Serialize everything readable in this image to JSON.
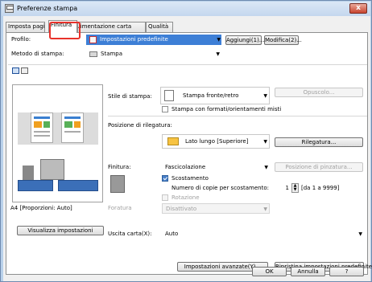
{
  "window": {
    "title": "Preferenze stampa",
    "close_label": "x"
  },
  "tabs": [
    {
      "label": "Imposta pagina"
    },
    {
      "label": "Finitura"
    },
    {
      "label": "Alimentazione carta"
    },
    {
      "label": "Qualità"
    }
  ],
  "profilo": {
    "label": "Profilo:",
    "value": "Impostazioni predefinite",
    "add_button": "Aggiungi(1)...",
    "edit_button": "Modifica(2)..."
  },
  "metodo": {
    "label": "Metodo di stampa:",
    "value": "Stampa"
  },
  "stile": {
    "label": "Stile di stampa:",
    "value": "Stampa fronte/retro",
    "opuscolo_button": "Opuscolo...",
    "mixed_label": "Stampa con formati/orientamenti misti"
  },
  "rilegatura": {
    "label": "Posizione di rilegatura:",
    "value": "Lato lungo [Superiore]",
    "button": "Rilegatura..."
  },
  "finitura": {
    "label": "Finitura:",
    "value": "Fascicolazione",
    "pinzatura_button": "Posizione di pinzatura...",
    "scostamento_label": "Scostamento",
    "copie_label": "Numero di copie per scostamento:",
    "copie_value": "1",
    "copie_range": "[da 1 a 9999]",
    "rotazione_label": "Rotazione",
    "foratura_label": "Foratura",
    "foratura_value": "Disattivato"
  },
  "preview": {
    "caption": "A4 [Proporzioni: Auto]",
    "show_settings_button": "Visualizza impostazioni"
  },
  "uscita": {
    "label": "Uscita carta(X):",
    "value": "Auto"
  },
  "bottom_buttons": {
    "advanced": "Impostazioni avanzate(Y)...",
    "restore": "Ripristina impostazioni predefinite"
  },
  "dialog_buttons": {
    "ok": "OK",
    "cancel": "Annulla",
    "help": "?"
  }
}
